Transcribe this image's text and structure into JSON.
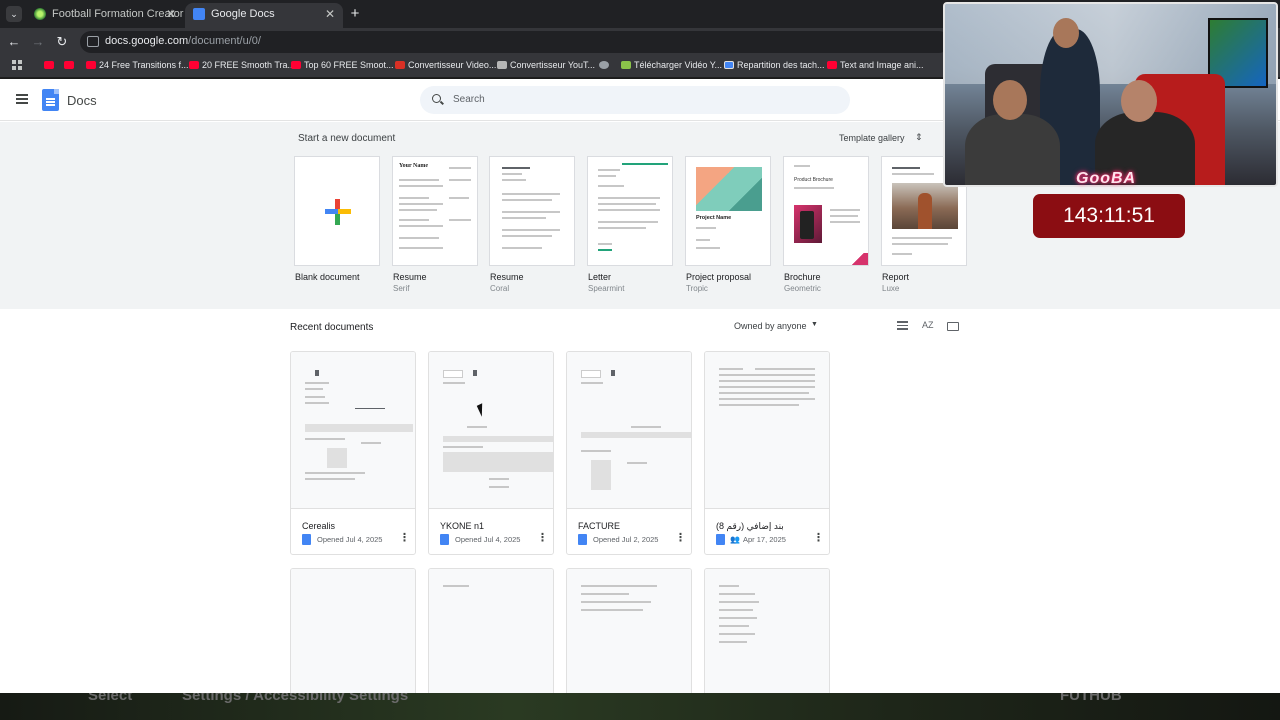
{
  "browser": {
    "tabs": [
      {
        "title": "Football Formation Creator - M",
        "active": false
      },
      {
        "title": "Google Docs",
        "active": true
      }
    ],
    "url_host": "docs.google.com",
    "url_path": "/document/u/0/",
    "bookmarks": [
      {
        "label": "",
        "icon": "youtube-icon"
      },
      {
        "label": "",
        "icon": "youtube-icon"
      },
      {
        "label": "24 Free Transitions f...",
        "icon": "youtube-icon"
      },
      {
        "label": "20 FREE Smooth Tra...",
        "icon": "youtube-icon"
      },
      {
        "label": "Top 60 FREE Smoot...",
        "icon": "youtube-icon"
      },
      {
        "label": "Convertisseur Video...",
        "icon": "z-icon"
      },
      {
        "label": "Convertisseur YouT...",
        "icon": "converter-icon"
      },
      {
        "label": "",
        "icon": "globe-icon"
      },
      {
        "label": "Télécharger Vidéo Y...",
        "icon": "download-icon"
      },
      {
        "label": "Repartition des tach...",
        "icon": "docs-icon"
      },
      {
        "label": "Text and Image ani...",
        "icon": "youtube-icon"
      }
    ]
  },
  "docs": {
    "app_name": "Docs",
    "search_placeholder": "Search",
    "start_heading": "Start a new document",
    "template_gallery": "Template gallery",
    "templates": [
      {
        "name": "Blank document",
        "sub": ""
      },
      {
        "name": "Resume",
        "sub": "Serif"
      },
      {
        "name": "Resume",
        "sub": "Coral"
      },
      {
        "name": "Letter",
        "sub": "Spearmint"
      },
      {
        "name": "Project proposal",
        "sub": "Tropic"
      },
      {
        "name": "Brochure",
        "sub": "Geometric"
      },
      {
        "name": "Report",
        "sub": "Luxe"
      }
    ],
    "template_thumb_text": {
      "resume_serif_heading": "Your Name",
      "project_name": "Project Name",
      "brochure_title": "Product Brochure"
    },
    "recent_heading": "Recent documents",
    "owned_filter": "Owned by anyone",
    "sort_label": "AZ",
    "recent_docs": [
      {
        "title": "Cerealis",
        "meta": "Opened Jul 4, 2025",
        "shared": false
      },
      {
        "title": "YKONE n1",
        "meta": "Opened Jul 4, 2025",
        "shared": false
      },
      {
        "title": "FACTURE",
        "meta": "Opened Jul 2, 2025",
        "shared": false
      },
      {
        "title": "بند إضافي (رقم 8)",
        "meta": "Apr 17, 2025",
        "shared": true
      }
    ]
  },
  "overlay": {
    "brand": "GooBA",
    "timer": "143:11:51",
    "bottom_hint_left": "Select",
    "bottom_hint_middle": "Settings / Accessibility Settings",
    "bottom_hint_right": "FUTHUB"
  },
  "colors": {
    "accent_blue": "#4285f4",
    "timer_bg": "#8b0d12",
    "brand_glow": "#ff2a6d"
  }
}
